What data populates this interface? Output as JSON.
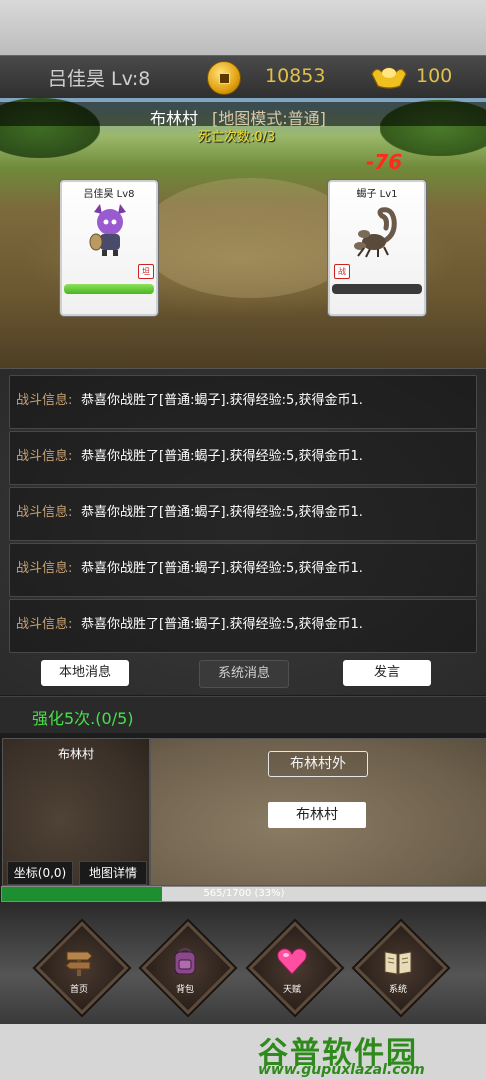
{
  "header": {
    "player_name": "吕佳昊 Lv:8",
    "gold": "10853",
    "ingots": "100"
  },
  "battle": {
    "map_name": "布林村",
    "map_mode": "[地图模式:普通]",
    "death_count": "死亡次数:0/3",
    "damage": "-76",
    "player": {
      "name": "吕佳昊 Lv8",
      "tag": "坦",
      "hp_fraction": 1.0
    },
    "enemy": {
      "name": "蝎子 Lv1",
      "tag": "战",
      "hp_fraction": 0.0
    }
  },
  "log": {
    "entries": [
      {
        "prefix": "战斗信息:",
        "message": "恭喜你战胜了[普通:蝎子].获得经验:5,获得金币1."
      },
      {
        "prefix": "战斗信息:",
        "message": "恭喜你战胜了[普通:蝎子].获得经验:5,获得金币1."
      },
      {
        "prefix": "战斗信息:",
        "message": "恭喜你战胜了[普通:蝎子].获得经验:5,获得金币1."
      },
      {
        "prefix": "战斗信息:",
        "message": "恭喜你战胜了[普通:蝎子].获得经验:5,获得金币1."
      },
      {
        "prefix": "战斗信息:",
        "message": "恭喜你战胜了[普通:蝎子].获得经验:5,获得金币1."
      }
    ],
    "tabs": {
      "local": "本地消息",
      "system": "系统消息",
      "speak": "发言"
    }
  },
  "enhance": {
    "text": "强化5次.(0/5)"
  },
  "minimap": {
    "label": "布林村",
    "coord_button": "坐标(0,0)",
    "detail_button": "地图详情"
  },
  "worldmap": {
    "outer_node": "布林村外",
    "current_node": "布林村"
  },
  "exp": {
    "text": "565/1700 (33%)",
    "fraction": 0.33
  },
  "nav": {
    "home": "首页",
    "bag": "背包",
    "talent": "天赋",
    "system": "系统"
  },
  "watermark": {
    "logo": "谷普软件园",
    "url": "www.gupuxlazal.com"
  },
  "colors": {
    "gold_text": "#e0c04a",
    "hp_green": "#48b61f",
    "log_prefix": "#c7a174",
    "enhance_green": "#48e048",
    "exp_green": "#1d8f31",
    "damage_red": "#ff2a1a"
  }
}
